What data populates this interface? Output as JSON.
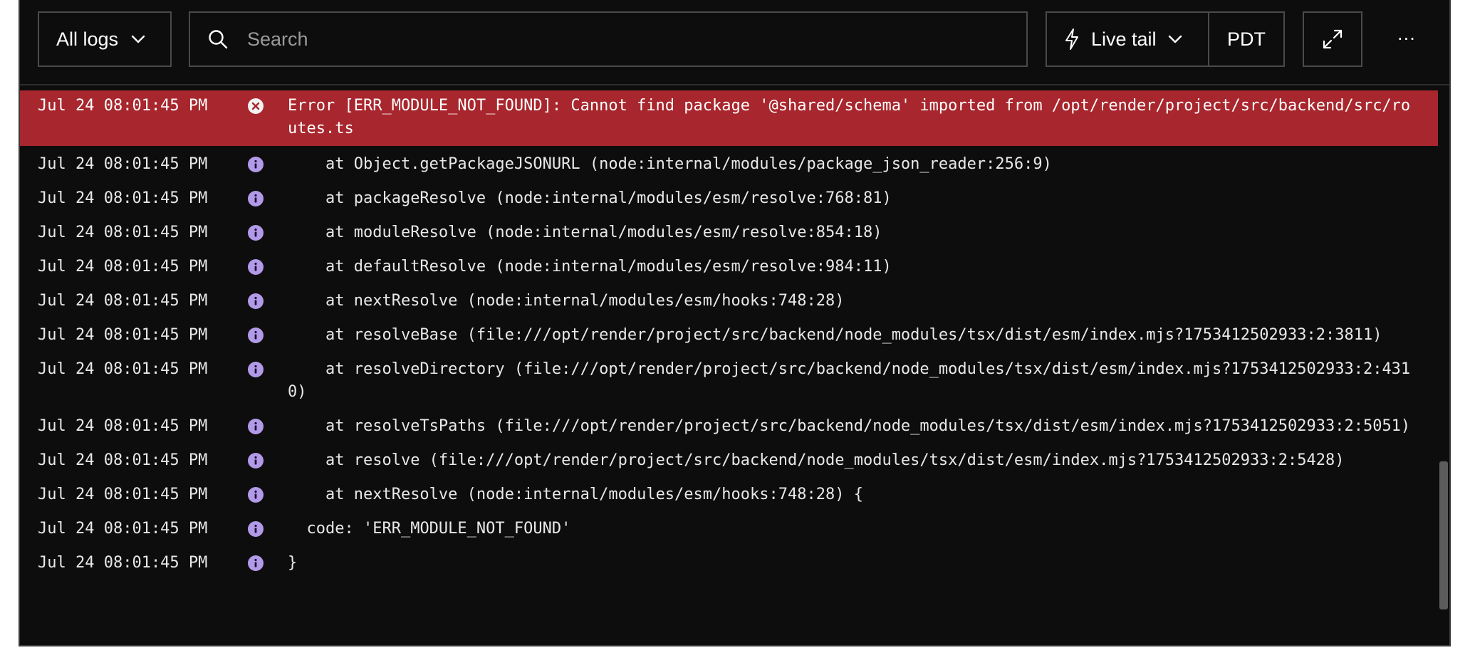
{
  "toolbar": {
    "filter_label": "All logs",
    "search_placeholder": "Search",
    "search_value": "",
    "live_tail_label": "Live tail",
    "timezone_label": "PDT",
    "more_label": "···"
  },
  "logs": [
    {
      "ts": "Jul 24 08:01:45 PM",
      "level": "error",
      "msg": "Error [ERR_MODULE_NOT_FOUND]: Cannot find package '@shared/schema' imported from /opt/render/project/src/backend/src/routes.ts"
    },
    {
      "ts": "Jul 24 08:01:45 PM",
      "level": "info",
      "msg": "    at Object.getPackageJSONURL (node:internal/modules/package_json_reader:256:9)"
    },
    {
      "ts": "Jul 24 08:01:45 PM",
      "level": "info",
      "msg": "    at packageResolve (node:internal/modules/esm/resolve:768:81)"
    },
    {
      "ts": "Jul 24 08:01:45 PM",
      "level": "info",
      "msg": "    at moduleResolve (node:internal/modules/esm/resolve:854:18)"
    },
    {
      "ts": "Jul 24 08:01:45 PM",
      "level": "info",
      "msg": "    at defaultResolve (node:internal/modules/esm/resolve:984:11)"
    },
    {
      "ts": "Jul 24 08:01:45 PM",
      "level": "info",
      "msg": "    at nextResolve (node:internal/modules/esm/hooks:748:28)"
    },
    {
      "ts": "Jul 24 08:01:45 PM",
      "level": "info",
      "msg": "    at resolveBase (file:///opt/render/project/src/backend/node_modules/tsx/dist/esm/index.mjs?1753412502933:2:3811)"
    },
    {
      "ts": "Jul 24 08:01:45 PM",
      "level": "info",
      "msg": "    at resolveDirectory (file:///opt/render/project/src/backend/node_modules/tsx/dist/esm/index.mjs?1753412502933:2:4310)"
    },
    {
      "ts": "Jul 24 08:01:45 PM",
      "level": "info",
      "msg": "    at resolveTsPaths (file:///opt/render/project/src/backend/node_modules/tsx/dist/esm/index.mjs?1753412502933:2:5051)"
    },
    {
      "ts": "Jul 24 08:01:45 PM",
      "level": "info",
      "msg": "    at resolve (file:///opt/render/project/src/backend/node_modules/tsx/dist/esm/index.mjs?1753412502933:2:5428)"
    },
    {
      "ts": "Jul 24 08:01:45 PM",
      "level": "info",
      "msg": "    at nextResolve (node:internal/modules/esm/hooks:748:28) {"
    },
    {
      "ts": "Jul 24 08:01:45 PM",
      "level": "info",
      "msg": "  code: 'ERR_MODULE_NOT_FOUND'"
    },
    {
      "ts": "Jul 24 08:01:45 PM",
      "level": "info",
      "msg": "}"
    }
  ],
  "icons": {
    "info": "info-icon",
    "error": "error-x-icon",
    "search": "search-icon",
    "bolt": "lightning-icon",
    "expand": "expand-icon"
  },
  "colors": {
    "background": "#0d0d0d",
    "error_row": "#a8262d",
    "info_icon": "#b39ae8"
  }
}
